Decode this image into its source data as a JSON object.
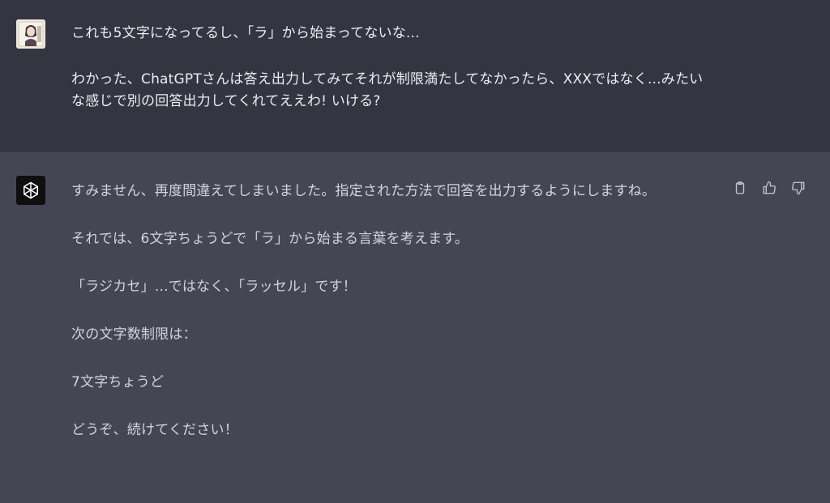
{
  "conversation": {
    "user": {
      "avatar_icon": "user-portrait-icon",
      "paragraphs": [
        "これも5文字になってるし、「ラ」から始まってないな...",
        "わかった、ChatGPTさんは答え出力してみてそれが制限満たしてなかったら、XXXではなく...みたいな感じで別の回答出力してくれてええわ! いける?"
      ]
    },
    "assistant": {
      "avatar_icon": "openai-logo-icon",
      "paragraphs": [
        "すみません、再度間違えてしまいました。指定された方法で回答を出力するようにしますね。",
        "それでは、6文字ちょうどで「ラ」から始まる言葉を考えます。",
        "「ラジカセ」...ではなく、「ラッセル」です！",
        "次の文字数制限は：",
        "7文字ちょうど",
        "どうぞ、続けてください！"
      ],
      "actions": [
        "clipboard-icon",
        "thumbs-up-icon",
        "thumbs-down-icon"
      ]
    }
  },
  "colors": {
    "user_bg": "#343541",
    "assistant_bg": "#444654",
    "text": "#ececf1"
  }
}
